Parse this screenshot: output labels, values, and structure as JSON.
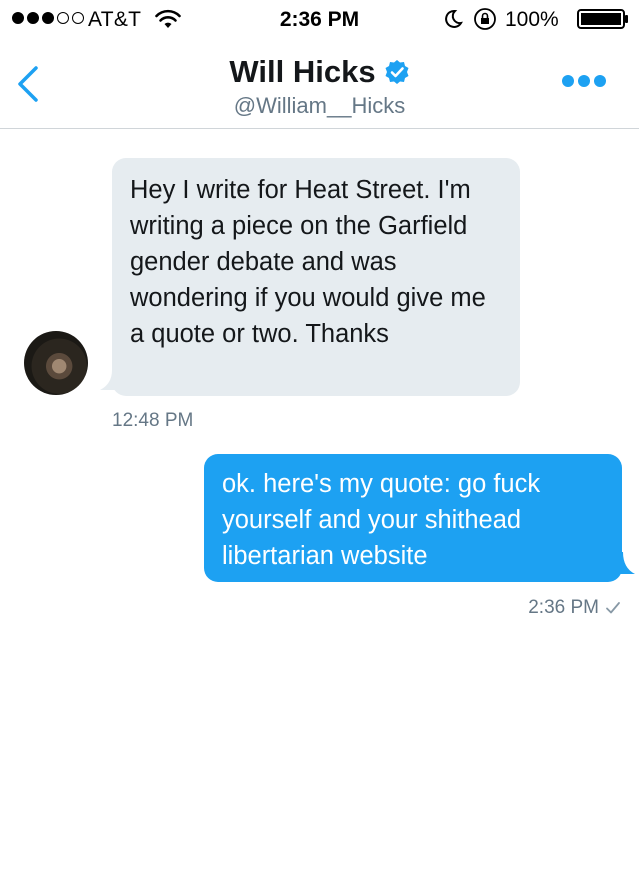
{
  "status_bar": {
    "carrier": "AT&T",
    "time": "2:36 PM",
    "battery_percent": "100%"
  },
  "header": {
    "name": "Will Hicks",
    "handle": "@William__Hicks"
  },
  "messages": [
    {
      "direction": "incoming",
      "text": "Hey I write for Heat Street. I'm writing a piece on the Garfield gender debate and was wondering if you would give me a quote or two. Thanks",
      "time": "12:48 PM"
    },
    {
      "direction": "outgoing",
      "text": "ok. here's my quote: go fuck yourself and your shithead libertarian website",
      "time": "2:36 PM",
      "status": "sent"
    }
  ],
  "icons": {
    "back": "chevron-left-icon",
    "verified": "verified-badge-icon",
    "more": "more-dots-icon",
    "wifi": "wifi-icon",
    "moon": "do-not-disturb-icon",
    "rotation_lock": "rotation-lock-icon",
    "battery": "battery-icon",
    "check": "check-icon"
  },
  "colors": {
    "accent": "#1da1f2",
    "incoming_bubble": "#e6ecf0",
    "secondary_text": "#657786"
  }
}
